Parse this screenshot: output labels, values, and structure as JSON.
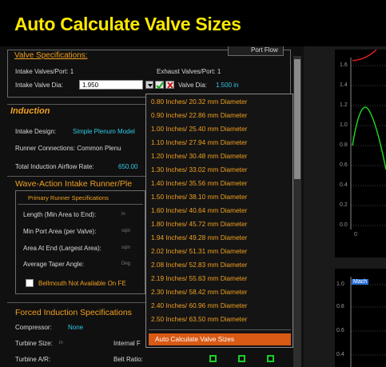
{
  "banner": {
    "title": "Auto Calculate Valve Sizes"
  },
  "valve_specs": {
    "header": "Valve Specifications:",
    "tab_partial": "Port Flow",
    "intake_ports": "Intake Valves/Port:  1",
    "exhaust_ports": "Exhaust Valves/Port:  1",
    "intake_dia_label": "Intake Valve Dia:",
    "intake_dia_value": "1.950",
    "valve_dia_label": "Valve Dia:",
    "valve_dia_value": "1.500 in"
  },
  "induction": {
    "header": "Induction",
    "design_label": "Intake Design:",
    "design_value": "Simple Plenum Model",
    "runner_label": "Runner Connections:  Common Plenu",
    "airflow_label": "Total Induction Airflow Rate:",
    "airflow_value": "650.00"
  },
  "wave": {
    "header": "Wave-Action Intake Runner/Ple",
    "primary_header": "Primary Runner Specifications",
    "rows": [
      {
        "label": "Length (Min Area to End):",
        "unit": "in"
      },
      {
        "label": "Min Port Area (per Valve):",
        "unit": "sqin"
      },
      {
        "label": "Area At End (Largest Area):",
        "unit": "sqin"
      },
      {
        "label": "Average Taper Angle:",
        "unit": "Deg"
      }
    ],
    "bellmouth": "Bellmouth Not Available On FE"
  },
  "forced": {
    "header": "Forced Induction Specifications",
    "compressor_label": "Compressor:",
    "compressor_value": "None",
    "turbine_size_label": "Turbine Size:",
    "turbine_size_unit": "in",
    "internal_label": "Internal F",
    "turbine_ar_label": "Turbine A/R:",
    "belt_ratio_label": "Belt Ratio:",
    "d_partial": "d"
  },
  "dropdown": {
    "items": [
      "0.80 Inches/ 20.32 mm Diameter",
      "0.90 Inches/ 22.86 mm Diameter",
      "1.00 Inches/ 25.40 mm Diameter",
      "1.10 Inches/ 27.94 mm Diameter",
      "1.20 Inches/ 30.48 mm Diameter",
      "1.30 Inches/ 33.02 mm Diameter",
      "1.40 Inches/ 35.56 mm Diameter",
      "1.50 Inches/ 38.10 mm Diameter",
      "1.60 Inches/ 40.64 mm Diameter",
      "1.80 Inches/ 45.72 mm Diameter",
      "1.94 Inches/ 49.28 mm Diameter",
      "2.02 Inches/ 51.31 mm Diameter",
      "2.08 Inches/ 52.83 mm Diameter",
      "2.19 Inches/ 55.63 mm Diameter",
      "2.30 Inches/ 58.42 mm Diameter",
      "2.40 Inches/ 60.96 mm Diameter",
      "2.50 Inches/ 63.50 mm Diameter"
    ],
    "action": "Auto Calculate Valve Sizes"
  },
  "charts": {
    "top_ticks": [
      "1.6",
      "1.4",
      "1.2",
      "1.0",
      "0.8",
      "0.6",
      "0.4",
      "0.2",
      "0.0"
    ],
    "top_x_tick": "0",
    "bottom_ticks": [
      "1.0",
      "0.8",
      "0.6",
      "0.4"
    ],
    "bottom_label": "Mach"
  },
  "colors": {
    "accent": "#f0a020",
    "banner": "#ffe800",
    "value": "#2fc9e6",
    "highlight": "#d85a14"
  }
}
